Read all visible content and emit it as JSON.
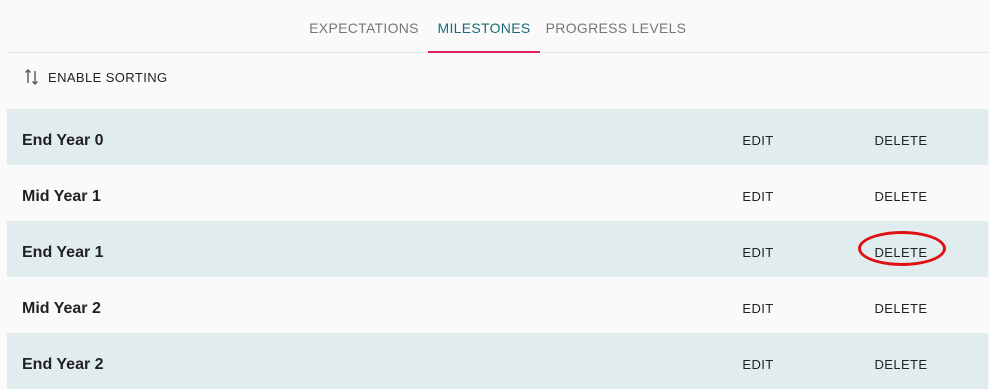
{
  "tabs": [
    {
      "label": "EXPECTATIONS",
      "active": false
    },
    {
      "label": "MILESTONES",
      "active": true
    },
    {
      "label": "PROGRESS LEVELS",
      "active": false
    }
  ],
  "toolbar": {
    "sort_label": "ENABLE SORTING",
    "sort_icon": "sort-arrows-icon"
  },
  "milestones": [
    {
      "title": "End Year 0",
      "edit_label": "EDIT",
      "delete_label": "DELETE"
    },
    {
      "title": "Mid Year 1",
      "edit_label": "EDIT",
      "delete_label": "DELETE"
    },
    {
      "title": "End Year 1",
      "edit_label": "EDIT",
      "delete_label": "DELETE"
    },
    {
      "title": "Mid Year 2",
      "edit_label": "EDIT",
      "delete_label": "DELETE"
    },
    {
      "title": "End Year 2",
      "edit_label": "EDIT",
      "delete_label": "DELETE"
    }
  ],
  "colors": {
    "active_tab": "#1c6a78",
    "tab_underline": "#e0235e",
    "shaded_row": "#e1ecee",
    "highlight_ring": "#e01010"
  }
}
